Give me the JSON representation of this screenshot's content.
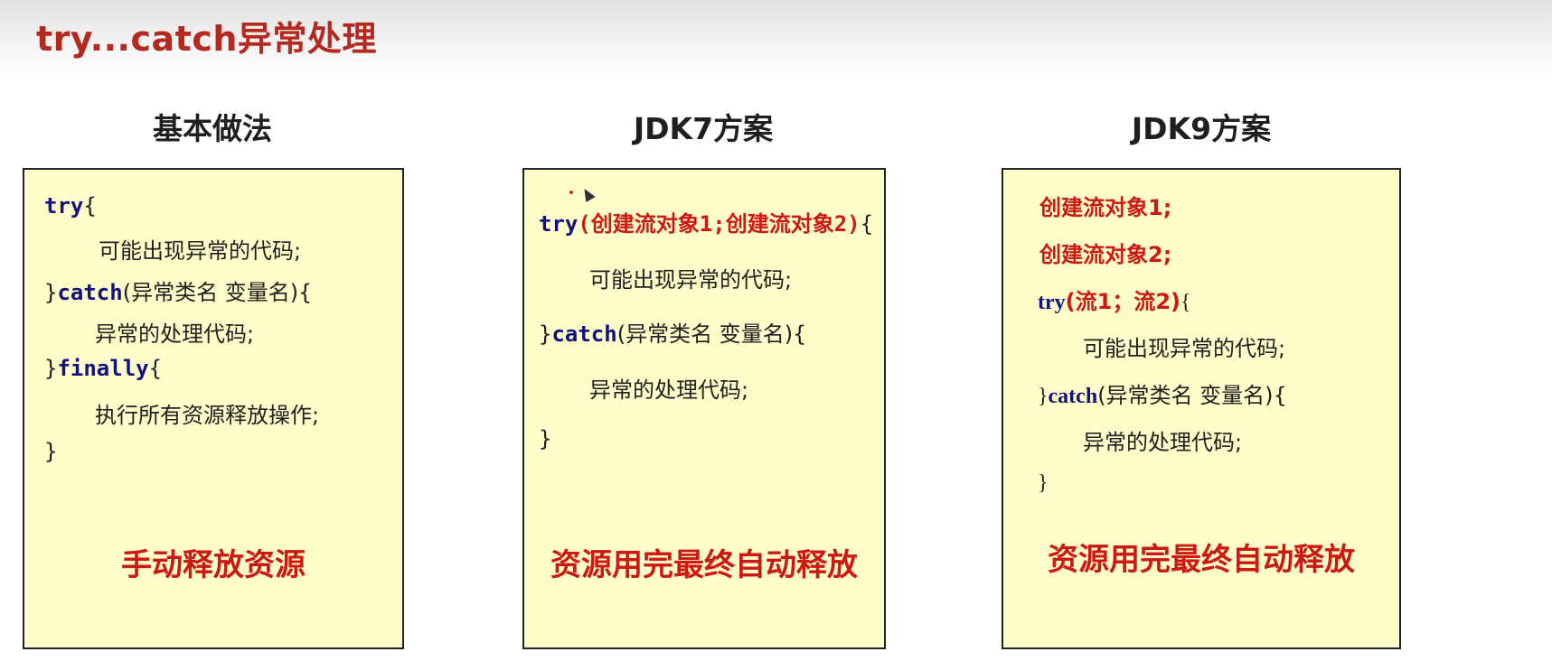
{
  "page": {
    "title": "try...catch异常处理"
  },
  "columns": [
    {
      "heading": "基本做法",
      "caption": "手动释放资源",
      "code": {
        "try_kw": "try",
        "try_open": "{",
        "body": "可能出现异常的代码;",
        "catch_close": "}",
        "catch_kw": "catch",
        "catch_params": "(异常类名 变量名){",
        "handler": "异常的处理代码;",
        "finally_close": "}",
        "finally_kw": "finally",
        "finally_open": "{",
        "finally_body": "执行所有资源释放操作;",
        "end": "}"
      }
    },
    {
      "heading": "JDK7方案",
      "caption": "资源用完最终自动释放",
      "code": {
        "try_kw": "try",
        "resources": "(创建流对象1;创建流对象2)",
        "try_open": "{",
        "body": "可能出现异常的代码;",
        "catch_close": "}",
        "catch_kw": "catch",
        "catch_params": "(异常类名 变量名){",
        "handler": "异常的处理代码;",
        "end": "}"
      }
    },
    {
      "heading": "JDK9方案",
      "caption": "资源用完最终自动释放",
      "code": {
        "create1": "创建流对象1;",
        "create2": "创建流对象2;",
        "try_kw": "try",
        "resources": "(流1；流2)",
        "try_open": "{",
        "body": "可能出现异常的代码;",
        "catch_close": "}",
        "catch_kw": "catch",
        "catch_params": "(异常类名 变量名){",
        "handler": "异常的处理代码;",
        "end": "}"
      }
    }
  ],
  "colors": {
    "title": "#b52a20",
    "keyword": "#11117f",
    "highlight": "#cc1a12",
    "card_fill": "#fffdc9"
  },
  "icons": [
    "mouse-cursor-icon"
  ]
}
